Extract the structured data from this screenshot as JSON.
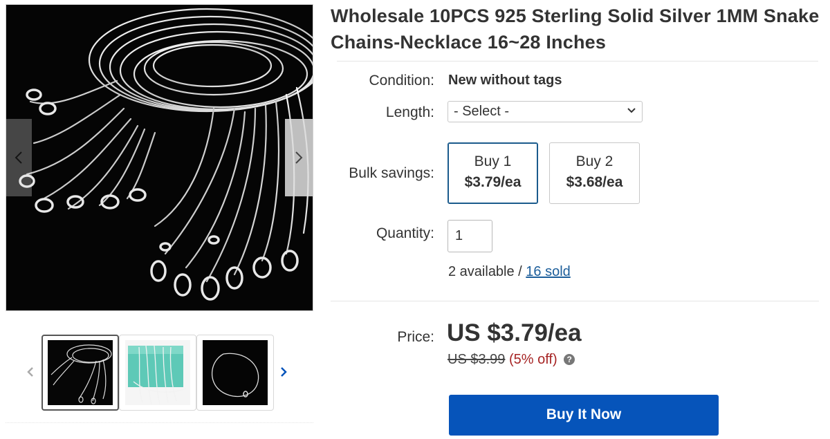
{
  "listing": {
    "title": "Wholesale 10PCS 925 Sterling Solid Silver 1MM Snake Chains-Necklace 16~28 Inches"
  },
  "gallery": {
    "main_image_alt": "",
    "thumbnails": [
      {
        "name": "thumb-silver-chains-black"
      },
      {
        "name": "thumb-silver-chains-teal-box"
      },
      {
        "name": "thumb-single-chain-black"
      }
    ]
  },
  "condition": {
    "label": "Condition:",
    "value": "New without tags"
  },
  "length": {
    "label": "Length:",
    "selected": "- Select -"
  },
  "bulk": {
    "label": "Bulk savings:",
    "options": [
      {
        "qty": "Buy 1",
        "price": "$3.79/ea"
      },
      {
        "qty": "Buy 2",
        "price": "$3.68/ea"
      }
    ]
  },
  "quantity": {
    "label": "Quantity:",
    "value": "1"
  },
  "availability": {
    "available": "2 available",
    "separator": " / ",
    "sold": "16 sold"
  },
  "price": {
    "label": "Price:",
    "current": "US $3.79/ea",
    "original": "US $3.99",
    "discount": "(5% off)",
    "info_glyph": "?"
  },
  "buy_now": {
    "label": "Buy It Now"
  },
  "colors": {
    "accent": "#0654ba",
    "link": "#1b5d9a",
    "discount": "#a62424",
    "selected_border": "#1a5a8c"
  }
}
